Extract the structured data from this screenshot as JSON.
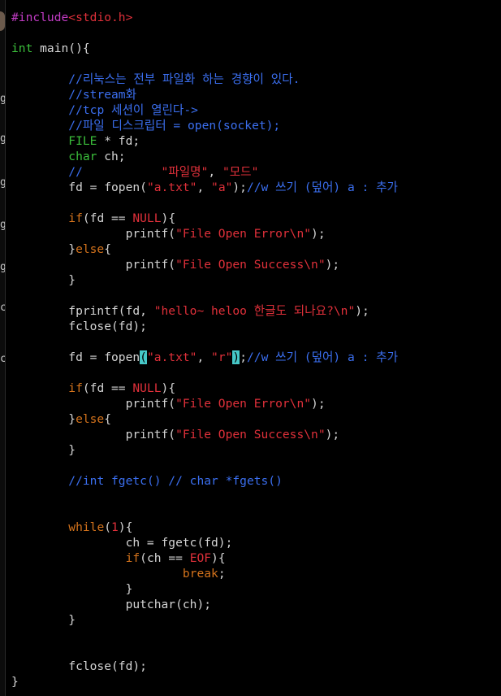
{
  "colors": {
    "background": "#000000",
    "preprocessor": "#c23cc4",
    "string": "#e0303a",
    "type": "#3bbf3b",
    "keyword": "#d4731c",
    "comment": "#3b6ff0",
    "plain": "#d4d4d4",
    "cursor": "#46c8c8"
  },
  "left_strip": {
    "fragments": [
      "g",
      "g",
      "g",
      "g",
      "g",
      "c",
      "c"
    ]
  },
  "code": {
    "lines": [
      [
        [
          "pre",
          "#include"
        ],
        [
          "str",
          "<stdio.h>"
        ]
      ],
      [],
      [
        [
          "type",
          "int"
        ],
        [
          "plain",
          " main(){"
        ]
      ],
      [],
      [
        [
          "plain",
          "        "
        ],
        [
          "cmt",
          "//리눅스는 전부 파일화 하는 경향이 있다."
        ]
      ],
      [
        [
          "plain",
          "        "
        ],
        [
          "cmt",
          "//stream화"
        ]
      ],
      [
        [
          "plain",
          "        "
        ],
        [
          "cmt",
          "//tcp 세션이 열린다->"
        ]
      ],
      [
        [
          "plain",
          "        "
        ],
        [
          "cmt",
          "//파일 디스크립터 = open(socket);"
        ]
      ],
      [
        [
          "plain",
          "        "
        ],
        [
          "type",
          "FILE"
        ],
        [
          "plain",
          " * fd;"
        ]
      ],
      [
        [
          "plain",
          "        "
        ],
        [
          "type",
          "char"
        ],
        [
          "plain",
          " ch;"
        ]
      ],
      [
        [
          "plain",
          "        "
        ],
        [
          "cmt",
          "//"
        ],
        [
          "plain",
          "           "
        ],
        [
          "str",
          "\"파일명\""
        ],
        [
          "plain",
          ", "
        ],
        [
          "str",
          "\"모드\""
        ]
      ],
      [
        [
          "plain",
          "        fd = fopen("
        ],
        [
          "str",
          "\"a.txt\""
        ],
        [
          "plain",
          ", "
        ],
        [
          "str",
          "\"a\""
        ],
        [
          "plain",
          ");"
        ],
        [
          "cmt",
          "//w 쓰기 (덮어) a : 추가"
        ]
      ],
      [],
      [
        [
          "plain",
          "        "
        ],
        [
          "kw",
          "if"
        ],
        [
          "plain",
          "(fd == "
        ],
        [
          "str",
          "NULL"
        ],
        [
          "plain",
          "){"
        ]
      ],
      [
        [
          "plain",
          "                printf("
        ],
        [
          "str",
          "\"File Open Error\\n\""
        ],
        [
          "plain",
          ");"
        ]
      ],
      [
        [
          "plain",
          "        }"
        ],
        [
          "kw",
          "else"
        ],
        [
          "plain",
          "{"
        ]
      ],
      [
        [
          "plain",
          "                printf("
        ],
        [
          "str",
          "\"File Open Success\\n\""
        ],
        [
          "plain",
          ");"
        ]
      ],
      [
        [
          "plain",
          "        }"
        ]
      ],
      [],
      [
        [
          "plain",
          "        fprintf(fd, "
        ],
        [
          "str",
          "\"hello~ heloo 한글도 되나요?\\n\""
        ],
        [
          "plain",
          ");"
        ]
      ],
      [
        [
          "plain",
          "        fclose(fd);"
        ]
      ],
      [],
      [
        [
          "plain",
          "        fd = fopen"
        ],
        [
          "cursor",
          "("
        ],
        [
          "str",
          "\"a.txt\""
        ],
        [
          "plain",
          ", "
        ],
        [
          "str",
          "\"r\""
        ],
        [
          "cursor",
          ")"
        ],
        [
          "plain",
          ";"
        ],
        [
          "cmt",
          "//w 쓰기 (덮어) a : 추가"
        ]
      ],
      [],
      [
        [
          "plain",
          "        "
        ],
        [
          "kw",
          "if"
        ],
        [
          "plain",
          "(fd == "
        ],
        [
          "str",
          "NULL"
        ],
        [
          "plain",
          "){"
        ]
      ],
      [
        [
          "plain",
          "                printf("
        ],
        [
          "str",
          "\"File Open Error\\n\""
        ],
        [
          "plain",
          ");"
        ]
      ],
      [
        [
          "plain",
          "        }"
        ],
        [
          "kw",
          "else"
        ],
        [
          "plain",
          "{"
        ]
      ],
      [
        [
          "plain",
          "                printf("
        ],
        [
          "str",
          "\"File Open Success\\n\""
        ],
        [
          "plain",
          ");"
        ]
      ],
      [
        [
          "plain",
          "        }"
        ]
      ],
      [],
      [
        [
          "plain",
          "        "
        ],
        [
          "cmt",
          "//int fgetc() // char *fgets()"
        ]
      ],
      [],
      [],
      [
        [
          "plain",
          "        "
        ],
        [
          "kw",
          "while"
        ],
        [
          "plain",
          "("
        ],
        [
          "str",
          "1"
        ],
        [
          "plain",
          "){"
        ]
      ],
      [
        [
          "plain",
          "                ch = fgetc(fd);"
        ]
      ],
      [
        [
          "plain",
          "                "
        ],
        [
          "kw",
          "if"
        ],
        [
          "plain",
          "(ch == "
        ],
        [
          "str",
          "EOF"
        ],
        [
          "plain",
          "){"
        ]
      ],
      [
        [
          "plain",
          "                        "
        ],
        [
          "kw",
          "break"
        ],
        [
          "plain",
          ";"
        ]
      ],
      [
        [
          "plain",
          "                }"
        ]
      ],
      [
        [
          "plain",
          "                putchar(ch);"
        ]
      ],
      [
        [
          "plain",
          "        }"
        ]
      ],
      [],
      [],
      [
        [
          "plain",
          "        fclose(fd);"
        ]
      ],
      [
        [
          "plain",
          "}"
        ]
      ]
    ]
  }
}
